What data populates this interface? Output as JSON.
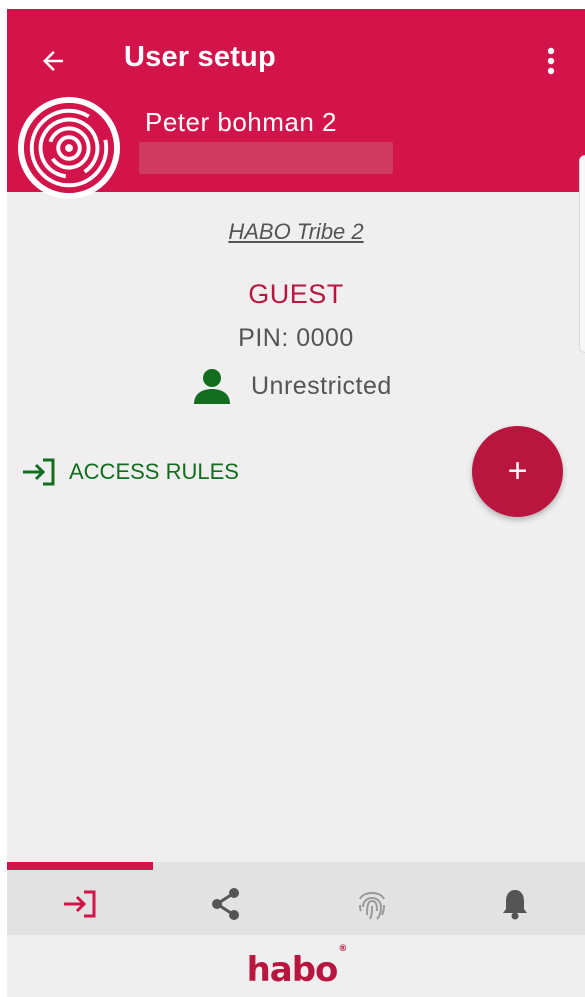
{
  "appbar": {
    "title": "User setup",
    "back_icon": "arrow-left-icon",
    "menu_icon": "more-vertical-icon",
    "user_name": "Peter bohman 2"
  },
  "details": {
    "tribe_link": "HABO Tribe 2",
    "role": "GUEST",
    "pin": "PIN:  0000",
    "restriction": "Unrestricted"
  },
  "access_rules": {
    "label": "ACCESS RULES",
    "icon": "login-arrow-icon"
  },
  "fab": {
    "label": "+"
  },
  "bottom_nav": {
    "items": [
      {
        "icon": "login-arrow-icon",
        "active": true
      },
      {
        "icon": "share-icon",
        "active": false
      },
      {
        "icon": "fingerprint-icon",
        "active": false
      },
      {
        "icon": "bell-icon",
        "active": false
      }
    ]
  },
  "footer": {
    "brand": "habo",
    "brand_mark": "®"
  },
  "colors": {
    "primary": "#d2144a",
    "accent_dark": "#b8163f",
    "green": "#136d1f",
    "background": "#efefef"
  }
}
